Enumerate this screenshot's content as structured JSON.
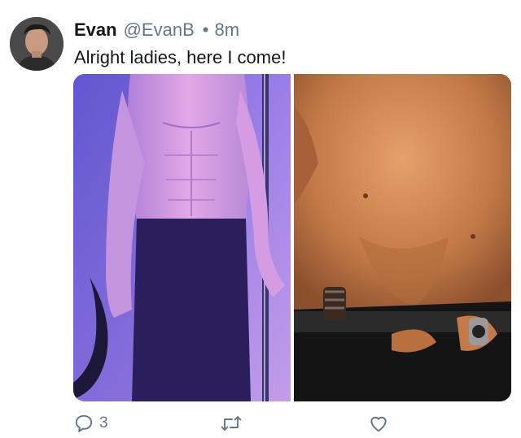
{
  "tweet": {
    "author_name": "Evan",
    "author_handle": "@EvanB",
    "separator": "•",
    "timestamp": "8m",
    "text": "Alright ladies, here I come!"
  },
  "media": {
    "photos": [
      {
        "description_icon": "photo-left"
      },
      {
        "description_icon": "photo-right"
      }
    ]
  },
  "actions": {
    "reply_count": "3",
    "retweet_icon": "retweet-icon",
    "like_icon": "heart-icon",
    "reply_icon": "reply-icon"
  },
  "colors": {
    "text_primary": "#14171a",
    "text_secondary": "#657786"
  }
}
